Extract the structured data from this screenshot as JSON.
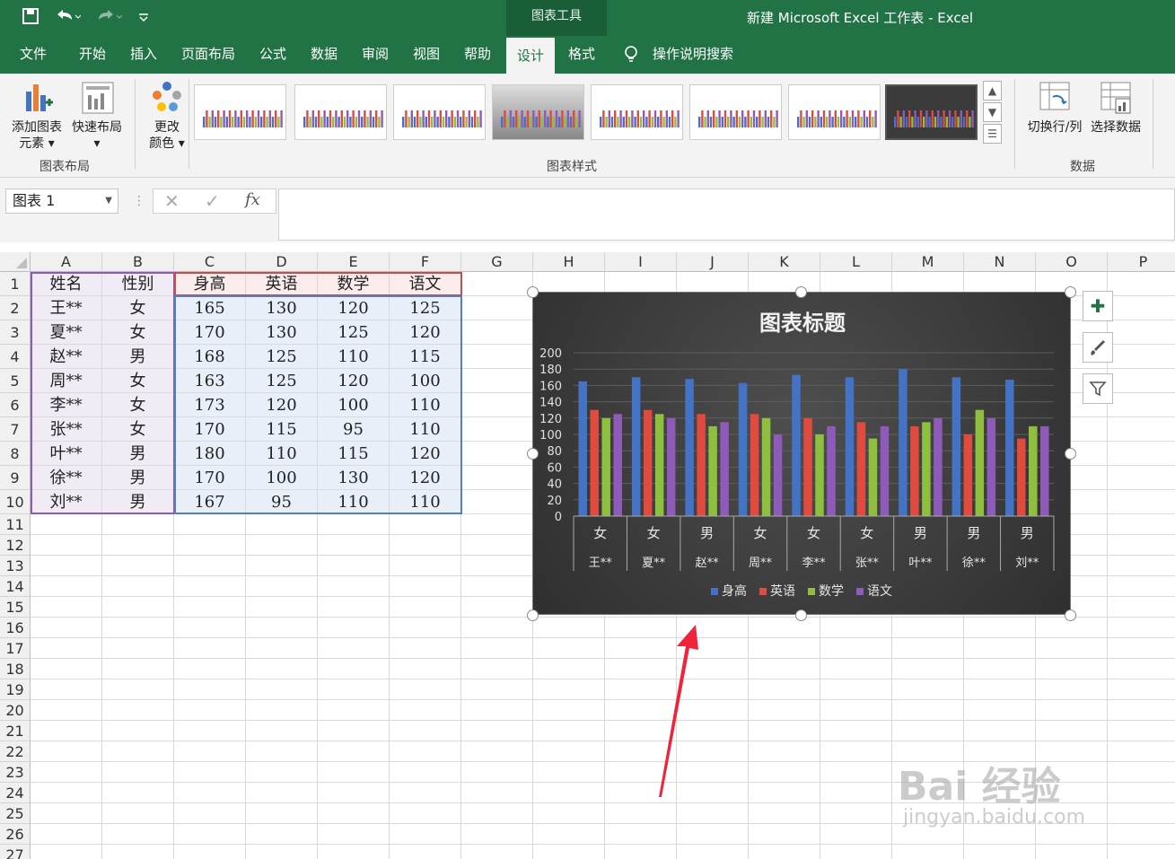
{
  "window": {
    "title": "新建 Microsoft Excel 工作表  -  Excel",
    "context_group": "图表工具"
  },
  "tabs": [
    "文件",
    "开始",
    "插入",
    "页面布局",
    "公式",
    "数据",
    "审阅",
    "视图",
    "帮助",
    "设计",
    "格式"
  ],
  "active_tab": "设计",
  "tell_me": "操作说明搜索",
  "ribbon": {
    "add_element": "添加图表元素",
    "add_element_l1": "添加图表",
    "add_element_l2": "元素",
    "quick_layout": "快速布局",
    "change_colors_l1": "更改",
    "change_colors_l2": "颜色",
    "group_layout": "图表布局",
    "group_styles": "图表样式",
    "switch_row_col": "切换行/列",
    "select_data": "选择数据",
    "group_data": "数据"
  },
  "name_box": "图表 1",
  "fx": "fx",
  "columns": [
    "A",
    "B",
    "C",
    "D",
    "E",
    "F",
    "G",
    "H",
    "I",
    "J",
    "K",
    "L",
    "M",
    "N",
    "O",
    "P"
  ],
  "rows": [
    "1",
    "2",
    "3",
    "4",
    "5",
    "6",
    "7",
    "8",
    "9",
    "10",
    "11",
    "12",
    "13",
    "14",
    "15",
    "16",
    "17",
    "18",
    "19",
    "20",
    "21",
    "22",
    "23",
    "24",
    "25",
    "26",
    "27"
  ],
  "table": {
    "headers": [
      "姓名",
      "性别",
      "身高",
      "英语",
      "数学",
      "语文"
    ],
    "data": [
      [
        "王**",
        "女",
        "165",
        "130",
        "120",
        "125"
      ],
      [
        "夏**",
        "女",
        "170",
        "130",
        "125",
        "120"
      ],
      [
        "赵**",
        "男",
        "168",
        "125",
        "110",
        "115"
      ],
      [
        "周**",
        "女",
        "163",
        "125",
        "120",
        "100"
      ],
      [
        "李**",
        "女",
        "173",
        "120",
        "100",
        "110"
      ],
      [
        "张**",
        "女",
        "170",
        "115",
        "95",
        "110"
      ],
      [
        "叶**",
        "男",
        "180",
        "110",
        "115",
        "120"
      ],
      [
        "徐**",
        "男",
        "170",
        "100",
        "130",
        "120"
      ],
      [
        "刘**",
        "男",
        "167",
        "95",
        "110",
        "110"
      ]
    ]
  },
  "chart_data": {
    "type": "bar",
    "title": "图表标题",
    "categories": [
      "王**",
      "夏**",
      "赵**",
      "周**",
      "李**",
      "张**",
      "叶**",
      "徐**",
      "刘**"
    ],
    "category_groups": [
      "女",
      "女",
      "男",
      "女",
      "女",
      "女",
      "男",
      "男",
      "男"
    ],
    "series": [
      {
        "name": "身高",
        "values": [
          165,
          170,
          168,
          163,
          173,
          170,
          180,
          170,
          167
        ],
        "color": "#4472c4"
      },
      {
        "name": "英语",
        "values": [
          130,
          130,
          125,
          125,
          120,
          115,
          110,
          100,
          95
        ],
        "color": "#e04a3f"
      },
      {
        "name": "数学",
        "values": [
          120,
          125,
          110,
          120,
          100,
          95,
          115,
          130,
          110
        ],
        "color": "#8fbf3f"
      },
      {
        "name": "语文",
        "values": [
          125,
          120,
          115,
          100,
          110,
          110,
          120,
          120,
          110
        ],
        "color": "#8e5cb8"
      }
    ],
    "yticks": [
      "0",
      "20",
      "40",
      "60",
      "80",
      "100",
      "120",
      "140",
      "160",
      "180",
      "200"
    ],
    "ylim": [
      0,
      200
    ],
    "legend": "bottom",
    "grid": true
  },
  "watermark": {
    "line1": "Bai 经验",
    "line2": "jingyan.baidu.com"
  }
}
